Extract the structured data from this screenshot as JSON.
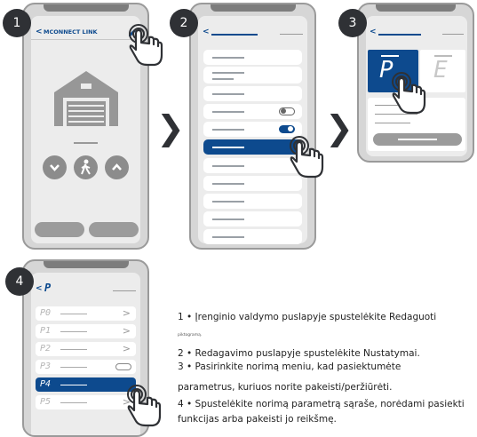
{
  "steps": {
    "one": "1",
    "two": "2",
    "three": "3",
    "four": "4"
  },
  "phone1": {
    "back_label": "MCONNECT LINK",
    "controls": [
      "chevron-down-icon",
      "pedestrian-icon",
      "chevron-up-icon"
    ]
  },
  "phone2": {
    "rows": 12,
    "toggles": [
      "off",
      "on"
    ]
  },
  "phone3": {
    "tile_selected": "P",
    "tile_other": "E"
  },
  "phone4": {
    "header_code": "P",
    "params": [
      "P0",
      "P1",
      "P2",
      "P3",
      "P4",
      "P5"
    ]
  },
  "instructions": {
    "line1": "1 • Įrenginio valdymo puslapyje spustelėkite Redaguoti",
    "line1_small": "piktogramą.",
    "line2": "2 • Redagavimo puslapyje spustelėkite Nustatymai.",
    "line3": "3 • Pasirinkite norimą meniu, kad pasiektumėte",
    "line4": "parametrus, kuriuos norite pakeisti/peržiūrėti.",
    "line5": "4 • Spustelėkite norimą parametrą sąraše, norėdami pasiekti",
    "line6": "funkcijas arba pakeisti jo reikšmę."
  },
  "colors": {
    "accent": "#0d4a8e",
    "badge": "#2f3135",
    "phone_frame": "#d6d6d6"
  }
}
